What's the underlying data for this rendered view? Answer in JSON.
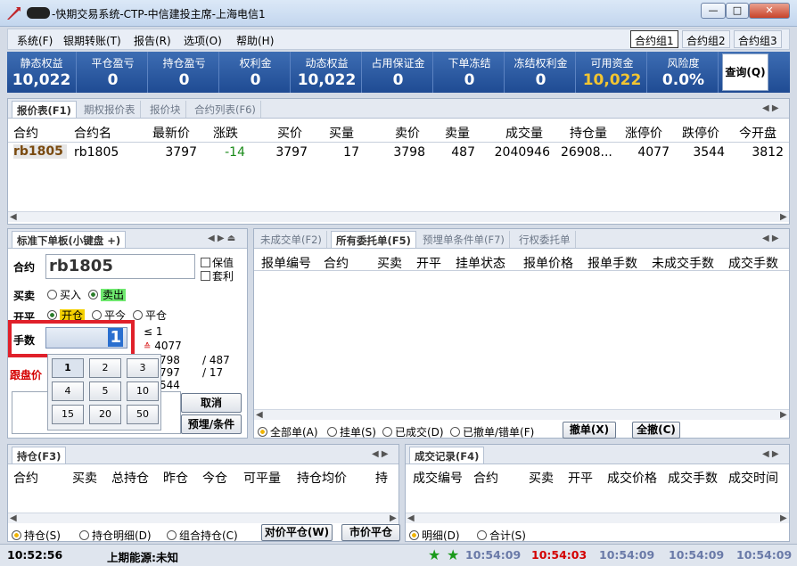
{
  "window": {
    "title": "-快期交易系统-CTP-中信建投主席-上海电信1",
    "min": "—",
    "max": "□",
    "close": "✕"
  },
  "menu": [
    "系统(F)",
    "银期转账(T)",
    "报告(R)",
    "选项(O)",
    "帮助(H)"
  ],
  "contract_groups": [
    "合约组1",
    "合约组2",
    "合约组3"
  ],
  "stats": [
    {
      "label": "静态权益",
      "value": "10,022"
    },
    {
      "label": "平仓盈亏",
      "value": "0"
    },
    {
      "label": "持仓盈亏",
      "value": "0"
    },
    {
      "label": "权利金",
      "value": "0"
    },
    {
      "label": "动态权益",
      "value": "10,022"
    },
    {
      "label": "占用保证金",
      "value": "0"
    },
    {
      "label": "下单冻结",
      "value": "0"
    },
    {
      "label": "冻结权利金",
      "value": "0"
    },
    {
      "label": "可用资金",
      "value": "10,022"
    },
    {
      "label": "风险度",
      "value": "0.0%"
    }
  ],
  "query_button": "查询(Q)",
  "quote_tabs": [
    "报价表(F1)",
    "期权报价表",
    "报价块",
    "合约列表(F6)"
  ],
  "quote_headers": [
    "合约",
    "合约名",
    "最新价",
    "涨跌",
    "买价",
    "买量",
    "卖价",
    "卖量",
    "成交量",
    "持仓量",
    "涨停价",
    "跌停价",
    "今开盘"
  ],
  "quote_row": [
    "rb1805",
    "rb1805",
    "3797",
    "-14",
    "3797",
    "17",
    "3798",
    "487",
    "2040946",
    "26908...",
    "4077",
    "3544",
    "3812"
  ],
  "order_panel": {
    "tab": "标准下单板(小键盘 +)",
    "contract_label": "合约",
    "contract_value": "rb1805",
    "hedge": "保值",
    "arbitrage": "套利",
    "side_label": "买卖",
    "buy": "买入",
    "sell": "卖出",
    "open_label": "开平",
    "open": "开仓",
    "close_today": "平今",
    "close": "平仓",
    "qty_label": "手数",
    "qty_value": "1",
    "le": "≤",
    "le_val": "1",
    "limit_up": "4077",
    "p1": "798",
    "v1": "487",
    "p2": "797",
    "v2": "17",
    "p3": "544",
    "follow_label": "跟盘价",
    "cancel": "取消",
    "preset": "预埋/条件",
    "keys": [
      "1",
      "2",
      "3",
      "4",
      "5",
      "10",
      "15",
      "20",
      "50"
    ]
  },
  "orders_tabs": [
    "未成交单(F2)",
    "所有委托单(F5)",
    "预埋单条件单(F7)",
    "行权委托单"
  ],
  "orders_headers": [
    "报单编号",
    "合约",
    "买卖",
    "开平",
    "挂单状态",
    "报单价格",
    "报单手数",
    "未成交手数",
    "成交手数"
  ],
  "orders_filters": [
    "全部单(A)",
    "挂单(S)",
    "已成交(D)",
    "已撤单/错单(F)"
  ],
  "orders_buttons": {
    "cancel": "撤单(X)",
    "cancel_all": "全撤(C)"
  },
  "position": {
    "tab": "持仓(F3)",
    "headers": [
      "合约",
      "买卖",
      "总持仓",
      "昨仓",
      "今仓",
      "可平量",
      "持仓均价",
      "持"
    ],
    "filters": [
      "持仓(S)",
      "持仓明细(D)",
      "组合持仓(C)"
    ],
    "btn1": "对价平仓(W)",
    "btn2": "市价平仓"
  },
  "trades": {
    "tab": "成交记录(F4)",
    "headers": [
      "成交编号",
      "合约",
      "买卖",
      "开平",
      "成交价格",
      "成交手数",
      "成交时间"
    ],
    "filters": [
      "明细(D)",
      "合计(S)"
    ]
  },
  "status": {
    "clock": "10:52:56",
    "source": "上期能源:未知",
    "times": [
      "10:54:09",
      "10:54:03",
      "10:54:09",
      "10:54:09",
      "10:54:09"
    ]
  },
  "colors": {
    "accent": "#1f4b93",
    "available": "#f2c531",
    "red": "#d40000",
    "green": "#1a8a1a"
  }
}
